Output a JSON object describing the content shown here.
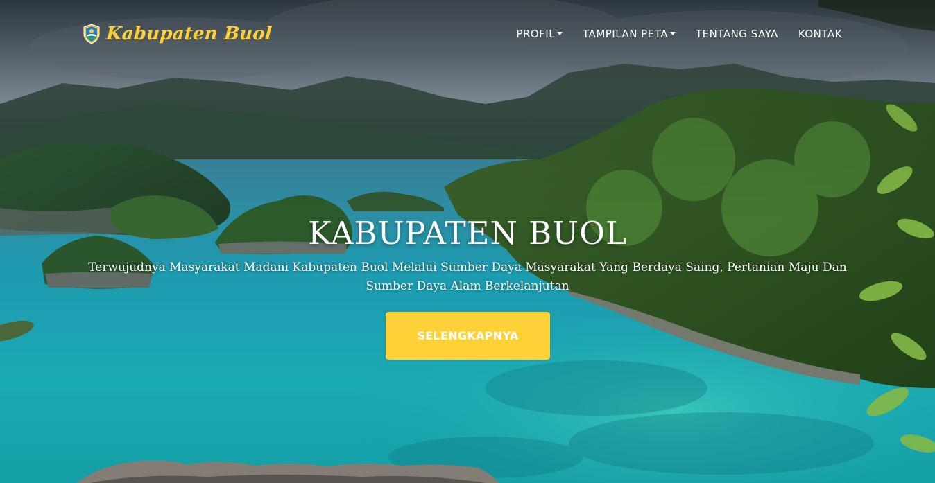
{
  "navbar": {
    "brand": {
      "logo_icon": "kabupaten-buol-emblem",
      "text": "Kabupaten Buol"
    },
    "items": [
      {
        "label": "PROFIL",
        "has_dropdown": true
      },
      {
        "label": "TAMPILAN PETA",
        "has_dropdown": true
      },
      {
        "label": "TENTANG SAYA",
        "has_dropdown": false
      },
      {
        "label": "KONTAK",
        "has_dropdown": false
      }
    ]
  },
  "hero": {
    "background": "tropical-lagoon-islands-photo",
    "title": "KABUPATEN BUOL",
    "subtitle": "Terwujudnya Masyarakat Madani Kabupaten Buol Melalui Sumber Daya Masyarakat Yang Berdaya Saing, Pertanian Maju Dan Sumber Daya Alam Berkelanjutan",
    "button_label": "SELENGKAPNYA"
  },
  "colors": {
    "accent": "#fed136",
    "text": "#ffffff",
    "water": "#1aa5b8"
  }
}
